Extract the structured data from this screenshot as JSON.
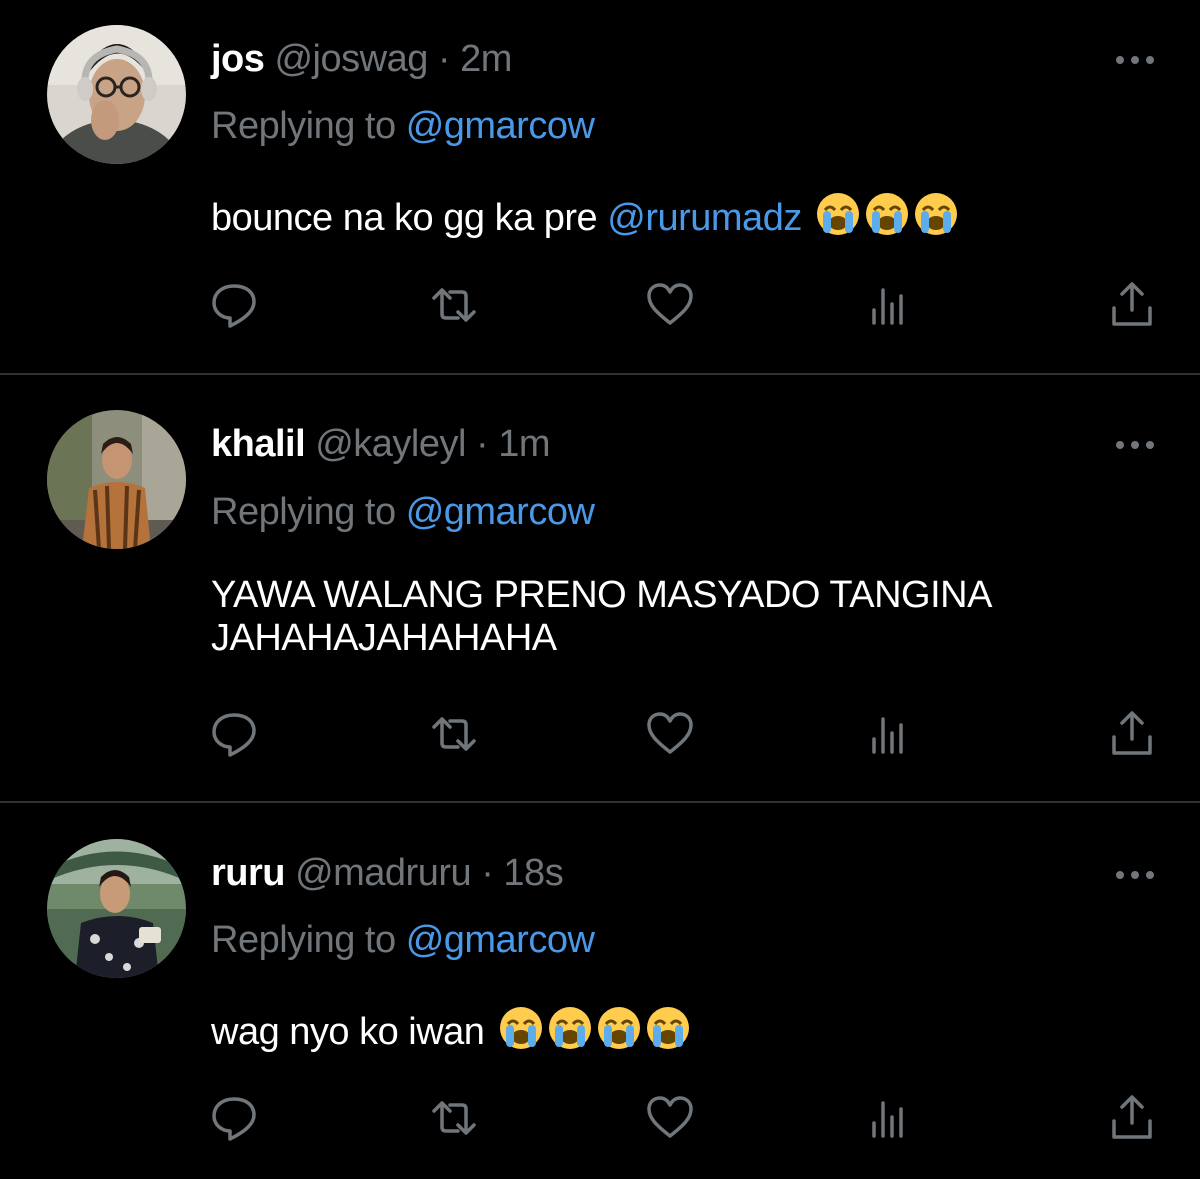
{
  "colors": {
    "background": "#000000",
    "name": "#ffffff",
    "secondary_text": "#71767b",
    "link": "#4a99e9",
    "divider": "#2f3336"
  },
  "tweets": [
    {
      "name": "jos",
      "handle": "@joswag",
      "separator": "·",
      "time": "2m",
      "replying_prefix": "Replying to",
      "replying_to": "@gmarcow",
      "text_before": "bounce na ko gg ka pre ",
      "mention": "@rurumadz",
      "text_after": "",
      "emoji": "loudly-crying-face",
      "emoji_count": 3
    },
    {
      "name": "khalil",
      "handle": "@kayleyl",
      "separator": "·",
      "time": "1m",
      "replying_prefix": "Replying to",
      "replying_to": "@gmarcow",
      "text_before": "YAWA WALANG PRENO MASYADO TANGINA JAHAHAJAHAHAHA",
      "mention": "",
      "text_after": "",
      "emoji": "",
      "emoji_count": 0
    },
    {
      "name": "ruru",
      "handle": "@madruru",
      "separator": "·",
      "time": "18s",
      "replying_prefix": "Replying to",
      "replying_to": "@gmarcow",
      "text_before": "wag nyo ko iwan ",
      "mention": "",
      "text_after": "",
      "emoji": "loudly-crying-face",
      "emoji_count": 4
    }
  ],
  "action_icons": [
    "reply-icon",
    "retweet-icon",
    "like-icon",
    "analytics-icon",
    "share-icon"
  ]
}
